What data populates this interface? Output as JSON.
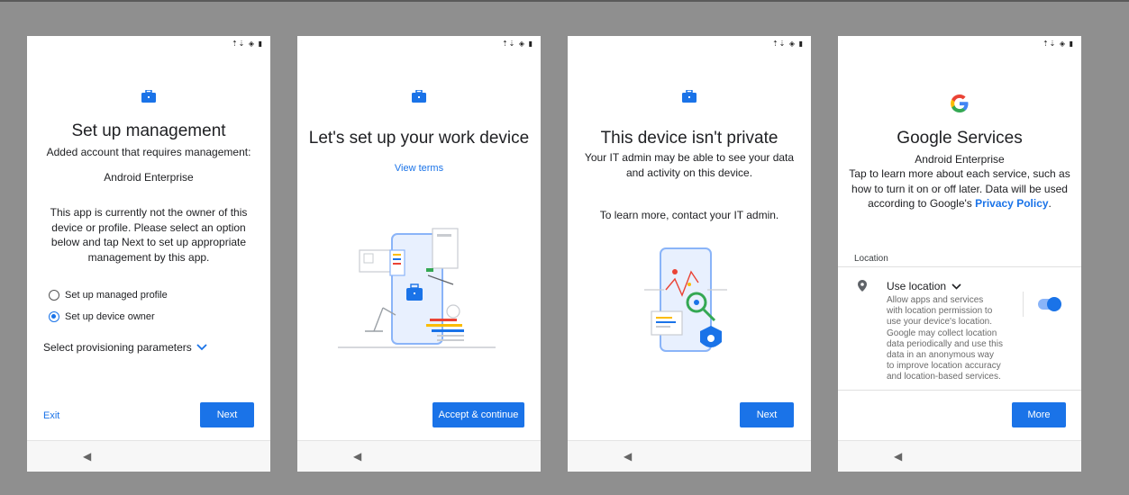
{
  "colors": {
    "accent": "#1a73e8",
    "background": "#8f8f8f",
    "text": "#202124"
  },
  "status_bar": {
    "icons": "wifi-icon battery-icon"
  },
  "screens": [
    {
      "title": "Set up management",
      "subtitle": "Added account that requires management:",
      "account": "Android Enterprise",
      "body": "This app is currently not the owner of this device or profile. Please select an option below and tap Next to set up appropriate management by this app.",
      "options": [
        {
          "label": "Set up managed profile",
          "selected": false
        },
        {
          "label": "Set up device owner",
          "selected": true
        }
      ],
      "expander": "Select provisioning parameters",
      "exit_label": "Exit",
      "next_label": "Next"
    },
    {
      "title": "Let's set up your work device",
      "link": "View terms",
      "button_label": "Accept & continue"
    },
    {
      "title": "This device isn't private",
      "body": "Your IT admin may be able to see your data and activity on this device.",
      "body2": "To learn more, contact your IT admin.",
      "button_label": "Next"
    },
    {
      "title": "Google Services",
      "account": "Android Enterprise",
      "body": "Tap to learn more about each service, such as how to turn it on or off later. Data will be used according to Google's",
      "policy_link": "Privacy Policy",
      "section_label": "Location",
      "setting_title": "Use location",
      "setting_desc_lines": [
        "Allow apps and services",
        "with location permission to",
        "use your device's location.",
        "Google may collect location",
        "data periodically and use this",
        "data in an anonymous way",
        "to improve location accuracy",
        "and location-based services."
      ],
      "toggle_on": true,
      "button_label": "More"
    }
  ]
}
